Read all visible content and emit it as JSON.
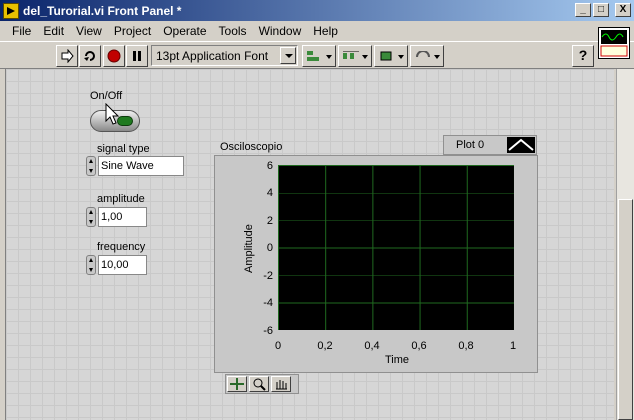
{
  "window": {
    "title": "del_Turorial.vi Front Panel *"
  },
  "window_buttons": {
    "minimize": "_",
    "maximize": "□",
    "close": "X"
  },
  "menu": [
    "File",
    "Edit",
    "View",
    "Project",
    "Operate",
    "Tools",
    "Window",
    "Help"
  ],
  "toolbar": {
    "font": "13pt Application Font",
    "help": "?"
  },
  "controls": {
    "onoff_label": "On/Off",
    "signal_type_label": "signal type",
    "signal_type_value": "Sine Wave",
    "amplitude_label": "amplitude",
    "amplitude_value": "1,00",
    "frequency_label": "frequency",
    "frequency_value": "10,00"
  },
  "graph": {
    "title": "Osciloscopio",
    "legend": "Plot 0",
    "ylabel": "Amplitude",
    "xlabel": "Time",
    "yticks": [
      "6",
      "4",
      "2",
      "0",
      "-2",
      "-4",
      "-6"
    ],
    "xticks": [
      "0",
      "0,2",
      "0,4",
      "0,6",
      "0,8",
      "1"
    ]
  },
  "colors": {
    "plot_bg": "#000000",
    "grid": "#1f6a1f",
    "lamp": "#1f7a1f",
    "titlebar": "#0a246a"
  }
}
